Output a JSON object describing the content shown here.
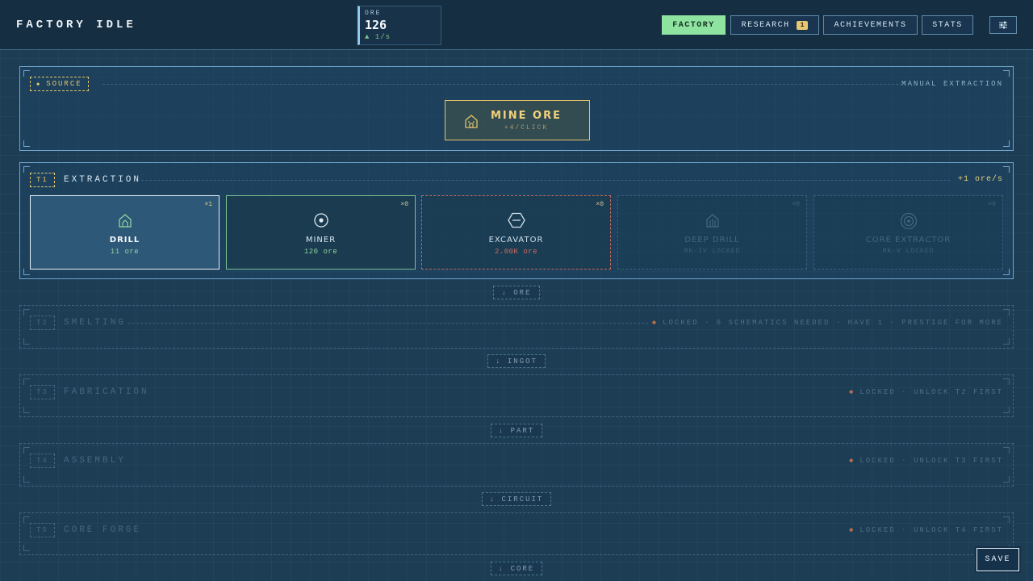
{
  "header": {
    "title": "FACTORY IDLE",
    "resource": {
      "label": "ORE",
      "value": "126",
      "rate": "▲ 1/s"
    },
    "nav": [
      {
        "label": "FACTORY",
        "active": true
      },
      {
        "label": "RESEARCH",
        "badge": "1"
      },
      {
        "label": "ACHIEVEMENTS"
      },
      {
        "label": "STATS"
      }
    ],
    "settings_icon": "sliders-icon"
  },
  "source": {
    "tag": "SOURCE",
    "right": "MANUAL EXTRACTION",
    "mine_button": {
      "label": "MINE ORE",
      "sub": "+4/CLICK"
    }
  },
  "tiers": [
    {
      "tag": "T1",
      "title": "EXTRACTION",
      "rate": "+1 ore/s",
      "cards": [
        {
          "name": "DRILL",
          "count": "×1",
          "sub": "11 ore",
          "icon": "drill-icon"
        },
        {
          "name": "MINER",
          "count": "×0",
          "sub": "120 ore",
          "icon": "miner-icon"
        },
        {
          "name": "EXCAVATOR",
          "count": "×0",
          "sub": "2.00K ore",
          "icon": "excavator-icon"
        },
        {
          "name": "DEEP DRILL",
          "count": "×0",
          "sub": "MK-IV LOCKED",
          "icon": "deep-drill-icon"
        },
        {
          "name": "CORE EXTRACTOR",
          "count": "×0",
          "sub": "MK-V LOCKED",
          "icon": "core-extractor-icon"
        }
      ]
    },
    {
      "tag": "T2",
      "title": "SMELTING",
      "locked": "LOCKED · 6 SCHEMATICS NEEDED · HAVE 1 · PRESTIGE FOR MORE"
    },
    {
      "tag": "T3",
      "title": "FABRICATION",
      "locked": "LOCKED · UNLOCK T2 FIRST"
    },
    {
      "tag": "T4",
      "title": "ASSEMBLY",
      "locked": "LOCKED · UNLOCK T3 FIRST"
    },
    {
      "tag": "T5",
      "title": "CORE FORGE",
      "locked": "LOCKED · UNLOCK T4 FIRST"
    }
  ],
  "flows": [
    "↓ ORE",
    "↓ INGOT",
    "↓ PART",
    "↓ CIRCUIT",
    "↓ CORE"
  ],
  "save_label": "SAVE",
  "colors": {
    "accent": "#8fe3a0",
    "gold": "#e3c16a",
    "danger": "#c96b5c",
    "panel_border": "#6fa6cb"
  }
}
